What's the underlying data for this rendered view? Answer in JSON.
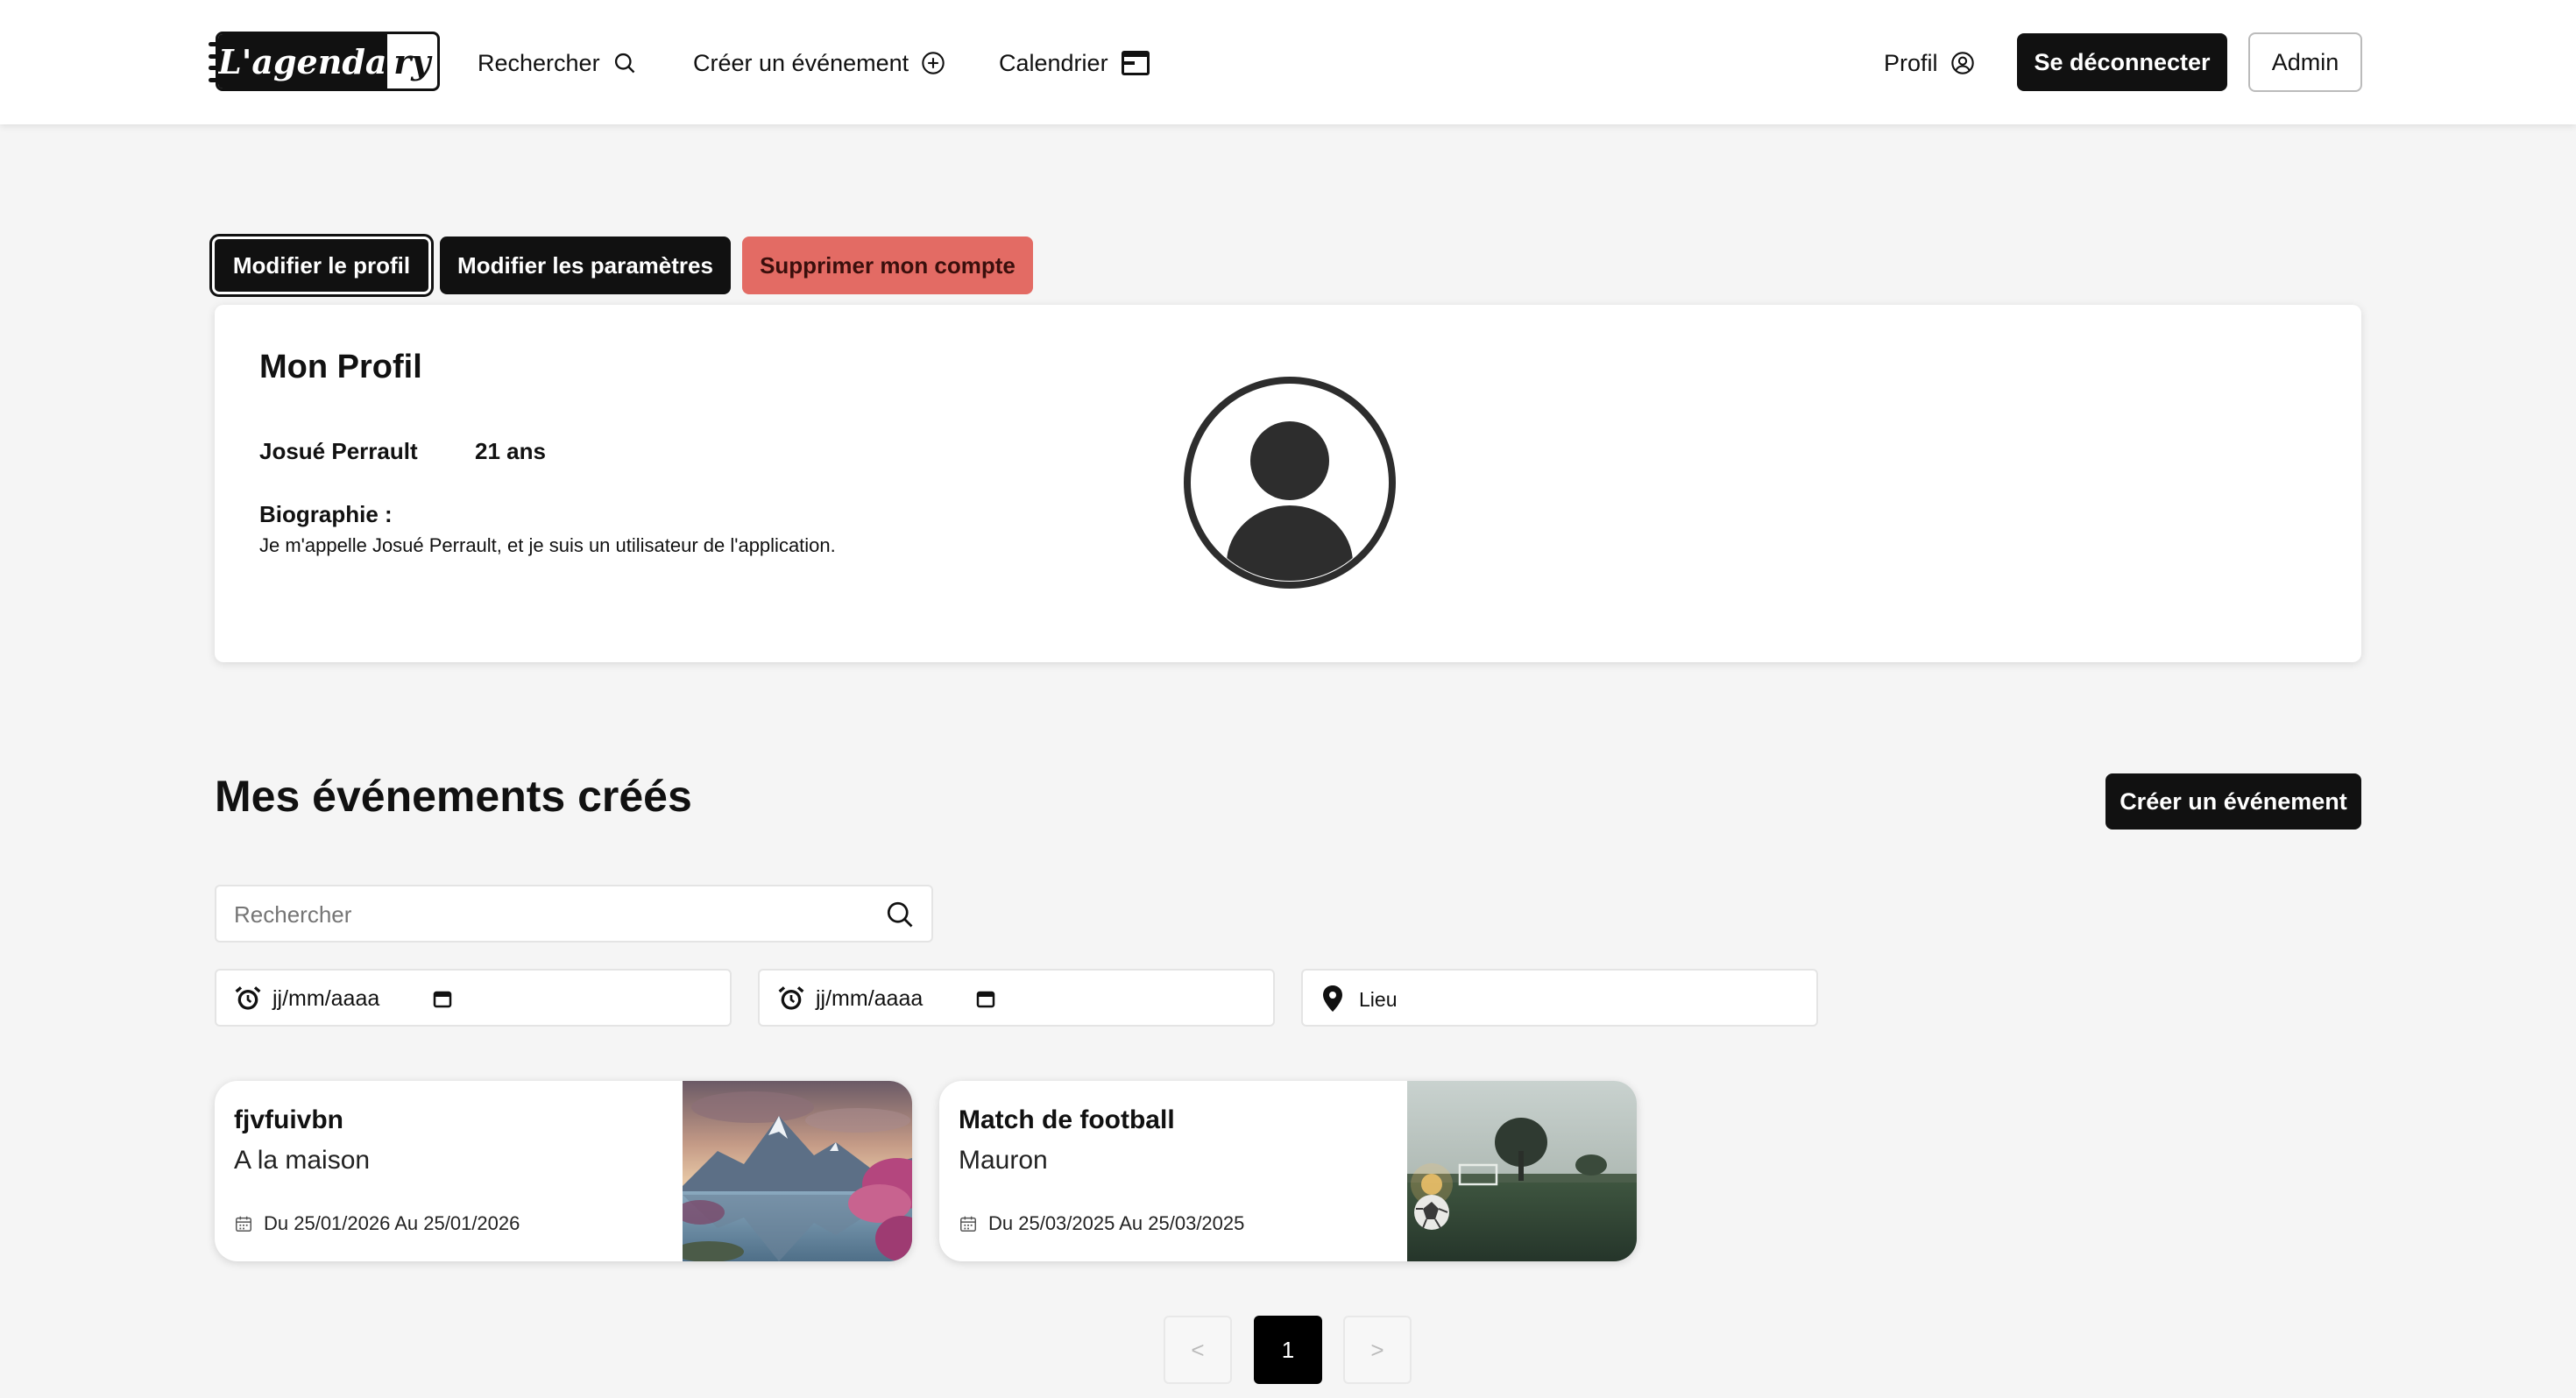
{
  "navbar": {
    "logo_main": "L'agenda",
    "logo_tail": "ry",
    "search_label": "Rechercher",
    "create_label": "Créer un événement",
    "calendar_label": "Calendrier",
    "profile_label": "Profil",
    "logout_label": "Se déconnecter",
    "admin_label": "Admin"
  },
  "tabs": {
    "edit_profile": "Modifier le profil",
    "edit_settings": "Modifier les paramètres",
    "delete_account": "Supprimer mon compte",
    "active": "edit_profile"
  },
  "profile": {
    "heading": "Mon Profil",
    "name": "Josué Perrault",
    "age": "21 ans",
    "bio_label": "Biographie :",
    "bio_text": "Je m'appelle Josué Perrault, et je suis un utilisateur de l'application."
  },
  "events_section": {
    "title": "Mes événements créés",
    "create_button": "Créer un événement",
    "search_placeholder": "Rechercher",
    "date_start_value": "jj/mm/aaaa",
    "date_end_value": "jj/mm/aaaa",
    "place_value": "Lieu"
  },
  "events": [
    {
      "title": "fjvfuivbn",
      "place": "A la maison",
      "dates": "Du 25/01/2026 Au 25/01/2026",
      "image": "mountain-lake-landscape"
    },
    {
      "title": "Match de football",
      "place": "Mauron",
      "dates": "Du 25/03/2025 Au 25/03/2025",
      "image": "football-field-with-ball"
    }
  ],
  "pagination": {
    "prev": "<",
    "current": "1",
    "next": ">"
  },
  "colors": {
    "primary": "#111111",
    "danger": "#e36b64",
    "background": "#f5f5f5",
    "card": "#ffffff"
  }
}
